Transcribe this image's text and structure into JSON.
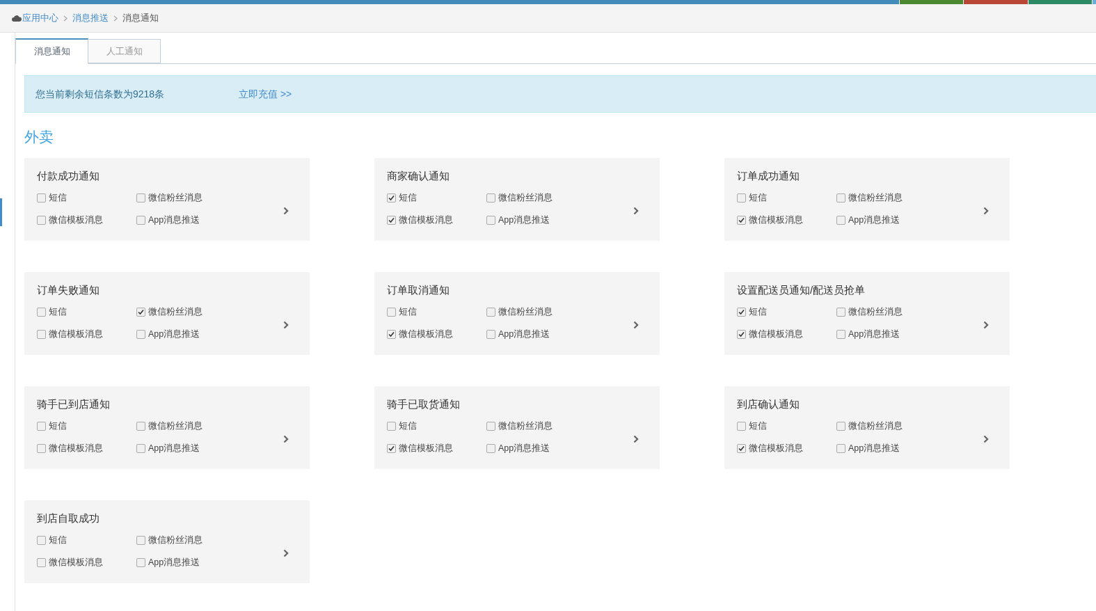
{
  "breadcrumb": [
    {
      "label": "应用中心",
      "kind": "link"
    },
    {
      "label": "消息推送",
      "kind": "link"
    },
    {
      "label": "消息通知",
      "kind": "current"
    }
  ],
  "tabs": [
    {
      "label": "消息通知",
      "selected": true
    },
    {
      "label": "人工通知",
      "selected": false
    }
  ],
  "alert": {
    "text": "您当前剩余短信条数为9218条",
    "link": "立即充值 >>"
  },
  "section_title": "外卖",
  "cards": [
    {
      "title": "付款成功通知",
      "options": [
        {
          "label": "短信",
          "checked": false
        },
        {
          "label": "微信粉丝消息",
          "checked": false
        },
        {
          "label": "微信模板消息",
          "checked": false
        },
        {
          "label": "App消息推送",
          "checked": false
        }
      ]
    },
    {
      "title": "商家确认通知",
      "options": [
        {
          "label": "短信",
          "checked": true
        },
        {
          "label": "微信粉丝消息",
          "checked": false
        },
        {
          "label": "微信模板消息",
          "checked": true
        },
        {
          "label": "App消息推送",
          "checked": false
        }
      ]
    },
    {
      "title": "订单成功通知",
      "options": [
        {
          "label": "短信",
          "checked": false
        },
        {
          "label": "微信粉丝消息",
          "checked": false
        },
        {
          "label": "微信模板消息",
          "checked": true
        },
        {
          "label": "App消息推送",
          "checked": false
        }
      ]
    },
    {
      "title": "订单失败通知",
      "options": [
        {
          "label": "短信",
          "checked": false
        },
        {
          "label": "微信粉丝消息",
          "checked": true
        },
        {
          "label": "微信模板消息",
          "checked": false
        },
        {
          "label": "App消息推送",
          "checked": false
        }
      ]
    },
    {
      "title": "订单取消通知",
      "options": [
        {
          "label": "短信",
          "checked": false
        },
        {
          "label": "微信粉丝消息",
          "checked": false
        },
        {
          "label": "微信模板消息",
          "checked": true
        },
        {
          "label": "App消息推送",
          "checked": false
        }
      ]
    },
    {
      "title": "设置配送员通知/配送员抢单",
      "options": [
        {
          "label": "短信",
          "checked": true
        },
        {
          "label": "微信粉丝消息",
          "checked": false
        },
        {
          "label": "微信模板消息",
          "checked": true
        },
        {
          "label": "App消息推送",
          "checked": false
        }
      ]
    },
    {
      "title": "骑手已到店通知",
      "options": [
        {
          "label": "短信",
          "checked": false
        },
        {
          "label": "微信粉丝消息",
          "checked": false
        },
        {
          "label": "微信模板消息",
          "checked": false
        },
        {
          "label": "App消息推送",
          "checked": false
        }
      ]
    },
    {
      "title": "骑手已取货通知",
      "options": [
        {
          "label": "短信",
          "checked": false
        },
        {
          "label": "微信粉丝消息",
          "checked": false
        },
        {
          "label": "微信模板消息",
          "checked": true
        },
        {
          "label": "App消息推送",
          "checked": false
        }
      ]
    },
    {
      "title": "到店确认通知",
      "options": [
        {
          "label": "短信",
          "checked": false
        },
        {
          "label": "微信粉丝消息",
          "checked": false
        },
        {
          "label": "微信模板消息",
          "checked": true
        },
        {
          "label": "App消息推送",
          "checked": false
        }
      ]
    },
    {
      "title": "到店自取成功",
      "options": [
        {
          "label": "短信",
          "checked": false
        },
        {
          "label": "微信粉丝消息",
          "checked": false
        },
        {
          "label": "微信模板消息",
          "checked": false
        },
        {
          "label": "App消息推送",
          "checked": false
        }
      ]
    }
  ]
}
